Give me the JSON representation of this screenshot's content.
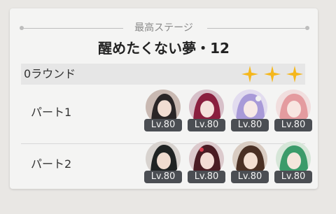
{
  "section_label": "最高ステージ",
  "stage_title": "醒めたくない夢・12",
  "round": {
    "label": "0ラウンド",
    "stars": 3,
    "star_color": "#f5b71c"
  },
  "parts": [
    {
      "label": "パート1",
      "characters": [
        {
          "level": "Lv.80",
          "avatar": "dark-hair-character"
        },
        {
          "level": "Lv.80",
          "avatar": "crimson-hair-character"
        },
        {
          "level": "Lv.80",
          "avatar": "lavender-hair-character"
        },
        {
          "level": "Lv.80",
          "avatar": "pink-hair-character"
        }
      ]
    },
    {
      "label": "パート2",
      "characters": [
        {
          "level": "Lv.80",
          "avatar": "black-hair-character"
        },
        {
          "level": "Lv.80",
          "avatar": "dark-red-hair-character"
        },
        {
          "level": "Lv.80",
          "avatar": "brown-hair-character"
        },
        {
          "level": "Lv.80",
          "avatar": "green-hair-character"
        }
      ]
    }
  ]
}
